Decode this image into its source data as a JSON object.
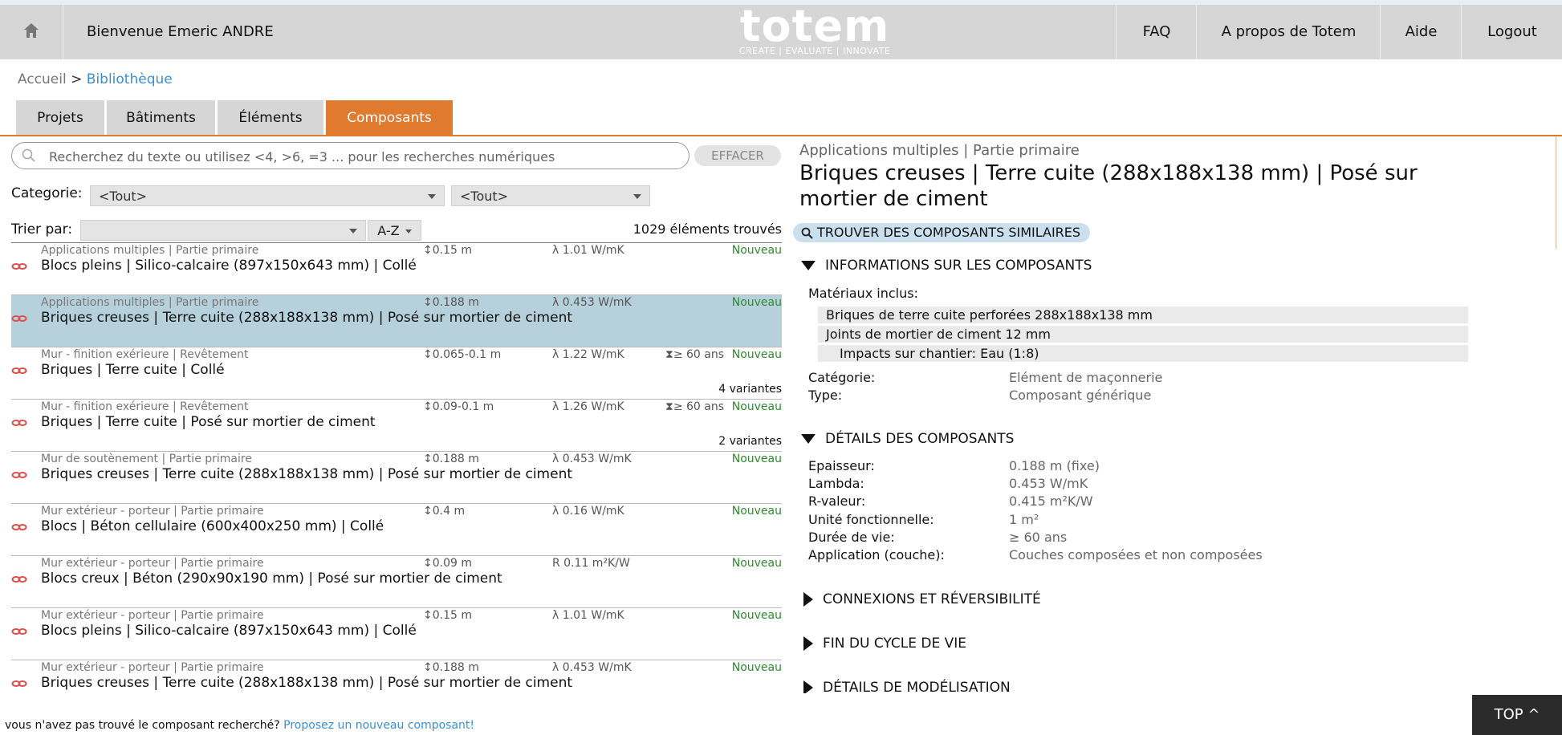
{
  "header": {
    "welcome": "Bienvenue Emeric ANDRE",
    "logo": "totem",
    "tagline": "CREATE | EVALUATE | INNOVATE",
    "nav": [
      "FAQ",
      "A propos de Totem",
      "Aide",
      "Logout"
    ]
  },
  "breadcrumb": {
    "home": "Accueil",
    "separator": ">",
    "current": "Bibliothèque"
  },
  "tabs": [
    "Projets",
    "Bâtiments",
    "Éléments",
    "Composants"
  ],
  "search": {
    "placeholder": "Recherchez du texte ou utilisez <4, >6, =3 ... pour les recherches numériques",
    "clear_label": "EFFACER"
  },
  "filters": {
    "category_label": "Categorie:",
    "category_1": "<Tout>",
    "category_2": "<Tout>",
    "sort_label": "Trier par:",
    "sort_value": "",
    "order": "A-Z",
    "found": "1029 éléments trouvés"
  },
  "list": [
    {
      "cat": "Applications multiples | Partie primaire",
      "name": "Blocs pleins | Silico-calcaire (897x150x643 mm) | Collé",
      "thick": "0.15 m",
      "lambda": "λ  1.01 W/mK",
      "life": "",
      "badge": "Nouveau",
      "variants": ""
    },
    {
      "cat": "Applications multiples | Partie primaire",
      "name": "Briques creuses | Terre cuite (288x188x138 mm) | Posé sur mortier de ciment",
      "thick": "0.188 m",
      "lambda": "λ  0.453 W/mK",
      "life": "",
      "badge": "Nouveau",
      "variants": ""
    },
    {
      "cat": "Mur - finition exérieure | Revêtement",
      "name": "Briques | Terre cuite | Collé",
      "thick": "0.065-0.1 m",
      "lambda": "λ  1.22 W/mK",
      "life": "≥ 60 ans",
      "badge": "Nouveau",
      "variants": "4 variantes"
    },
    {
      "cat": "Mur - finition exérieure | Revêtement",
      "name": "Briques | Terre cuite | Posé sur mortier de ciment",
      "thick": "0.09-0.1 m",
      "lambda": "λ  1.26 W/mK",
      "life": "≥ 60 ans",
      "badge": "Nouveau",
      "variants": "2 variantes"
    },
    {
      "cat": "Mur de soutènement | Partie primaire",
      "name": "Briques creuses | Terre cuite (288x188x138 mm) | Posé sur mortier de ciment",
      "thick": "0.188 m",
      "lambda": "λ  0.453 W/mK",
      "life": "",
      "badge": "Nouveau",
      "variants": ""
    },
    {
      "cat": "Mur extérieur - porteur | Partie primaire",
      "name": "Blocs | Béton cellulaire (600x400x250 mm) | Collé",
      "thick": "0.4 m",
      "lambda": "λ  0.16 W/mK",
      "life": "",
      "badge": "Nouveau",
      "variants": ""
    },
    {
      "cat": "Mur extérieur - porteur | Partie primaire",
      "name": "Blocs creux | Béton (290x90x190 mm) | Posé sur mortier de ciment",
      "thick": "0.09 m",
      "lambda": "R  0.11 m²K/W",
      "life": "",
      "badge": "Nouveau",
      "variants": ""
    },
    {
      "cat": "Mur extérieur - porteur | Partie primaire",
      "name": "Blocs pleins | Silico-calcaire (897x150x643 mm) | Collé",
      "thick": "0.15 m",
      "lambda": "λ  1.01 W/mK",
      "life": "",
      "badge": "Nouveau",
      "variants": ""
    },
    {
      "cat": "Mur extérieur - porteur | Partie primaire",
      "name": "Briques creuses | Terre cuite (288x188x138 mm) | Posé sur mortier de ciment",
      "thick": "0.188 m",
      "lambda": "λ  0.453 W/mK",
      "life": "",
      "badge": "Nouveau",
      "variants": ""
    }
  ],
  "footer": {
    "text": "vous n'avez pas trouvé le composant recherché?",
    "link": "Proposez un nouveau composant!"
  },
  "detail": {
    "category": "Applications multiples | Partie primaire",
    "title": "Briques creuses | Terre cuite (288x188x138 mm) | Posé sur mortier de ciment",
    "similar_button": "TROUVER DES COMPOSANTS SIMILAIRES",
    "info_section": "INFORMATIONS SUR LES COMPOSANTS",
    "materials_label": "Matériaux inclus:",
    "materials": [
      "Briques de terre cuite perforées 288x188x138 mm",
      "Joints de mortier de ciment 12 mm",
      "Impacts sur chantier:  Eau (1:8)"
    ],
    "info": [
      {
        "label": "Catégorie:",
        "value": "Elément de maçonnerie"
      },
      {
        "label": "Type:",
        "value": "Composant générique"
      }
    ],
    "details_section": "DÉTAILS DES COMPOSANTS",
    "details": [
      {
        "label": "Epaisseur:",
        "value": "0.188 m (fixe)"
      },
      {
        "label": "Lambda:",
        "value": "0.453 W/mK"
      },
      {
        "label": "R-valeur:",
        "value": "0.415 m²K/W"
      },
      {
        "label": "Unité fonctionnelle:",
        "value": "1 m²"
      },
      {
        "label": "Durée de vie:",
        "value": "≥ 60 ans"
      },
      {
        "label": "Application (couche):",
        "value": "Couches composées et non composées"
      }
    ],
    "sections_collapsed": [
      "CONNEXIONS ET RÉVERSIBILITÉ",
      "FIN DU CYCLE DE VIE",
      "DÉTAILS DE MODÉLISATION"
    ]
  },
  "top_button": "TOP ^",
  "colors": {
    "accent": "#e07a2f",
    "selected_row": "#b7d1dc",
    "link": "#3a8fd4",
    "new_badge": "#2e8b2e",
    "header_bg": "#d6d6d6"
  }
}
